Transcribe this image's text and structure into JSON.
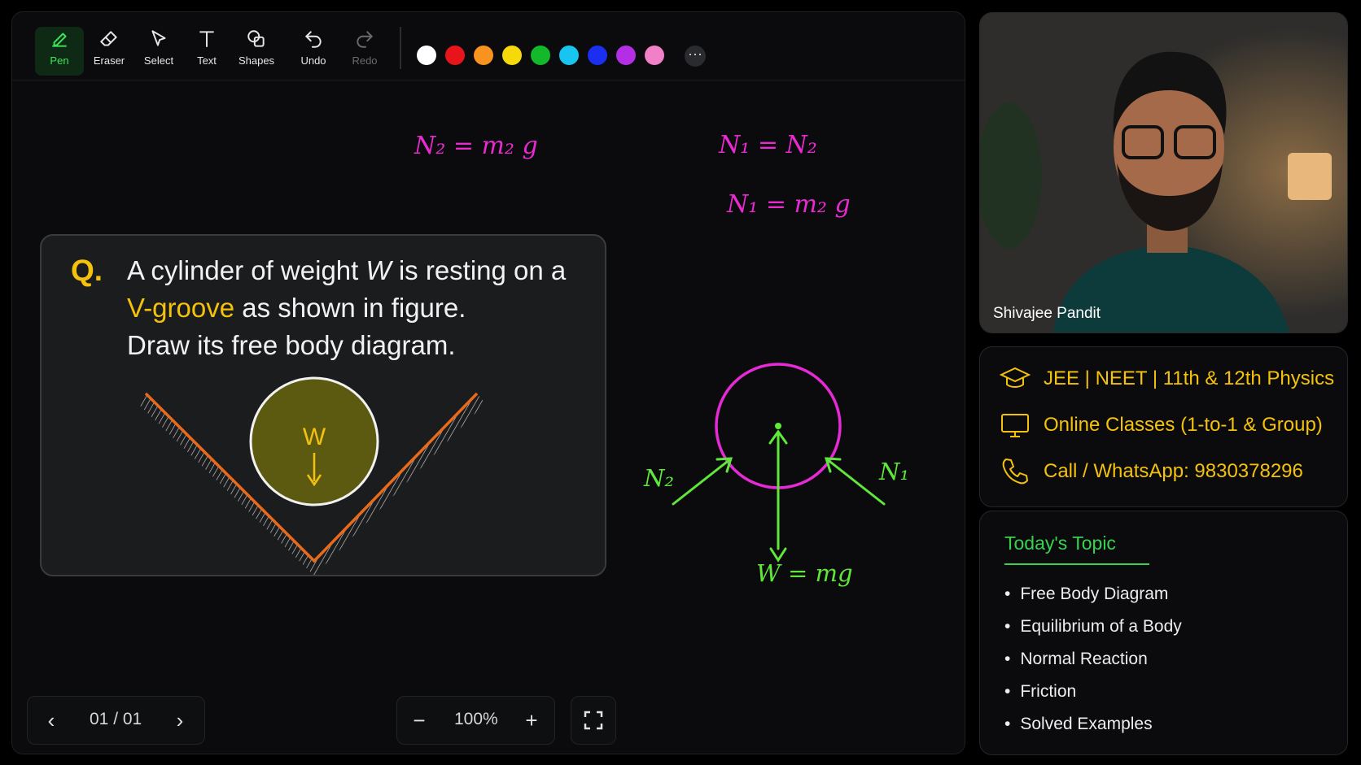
{
  "toolbar": {
    "tools": [
      {
        "label": "Pen",
        "icon": "pen-icon",
        "active": true
      },
      {
        "label": "Eraser",
        "icon": "eraser-icon"
      },
      {
        "label": "Select",
        "icon": "cursor-icon"
      },
      {
        "label": "Text",
        "icon": "text-icon"
      },
      {
        "label": "Shapes",
        "icon": "shapes-icon"
      },
      {
        "label": "Undo",
        "icon": "undo-icon"
      },
      {
        "label": "Redo",
        "icon": "redo-icon",
        "disabled": true
      }
    ],
    "colors": [
      "#ffffff",
      "#e8141b",
      "#f7931e",
      "#f6d90a",
      "#14b82b",
      "#18c4f0",
      "#1b2ff0",
      "#b42ee6",
      "#f080c8"
    ],
    "more_label": "···"
  },
  "annotations": {
    "eq1": "N₂ = m₂ g",
    "eq2": "N₁ = N₂",
    "eq3": "N₁ = m₂ g",
    "fbd_n2": "N₂",
    "fbd_n1": "N₁",
    "fbd_w": "W = mg"
  },
  "question": {
    "mark": "Q.",
    "line1_a": "A cylinder of weight ",
    "line1_w": "W",
    "line1_b": " is resting on a",
    "line2_hl": "V-groove",
    "line2_rest": " as shown in figure.",
    "line3": "Draw its free body diagram.",
    "figure_label": "W"
  },
  "pager": {
    "prev": "‹",
    "text": "01 / 01",
    "next": "›"
  },
  "zoom": {
    "minus": "−",
    "value": "100%",
    "plus": "+"
  },
  "video": {
    "name": "Shivajee Pandit"
  },
  "info": {
    "rows": [
      {
        "icon": "graduation-cap-icon",
        "text": "JEE | NEET | 11th & 12th Physics"
      },
      {
        "icon": "monitor-icon",
        "text": "Online Classes (1-to-1 & Group)"
      },
      {
        "icon": "phone-icon",
        "text": "Call / WhatsApp: 9830378296"
      }
    ]
  },
  "topic": {
    "title": "Today's Topic",
    "items": [
      "Free Body Diagram",
      "Equilibrium of a Body",
      "Normal Reaction",
      "Friction",
      "Solved Examples"
    ]
  }
}
